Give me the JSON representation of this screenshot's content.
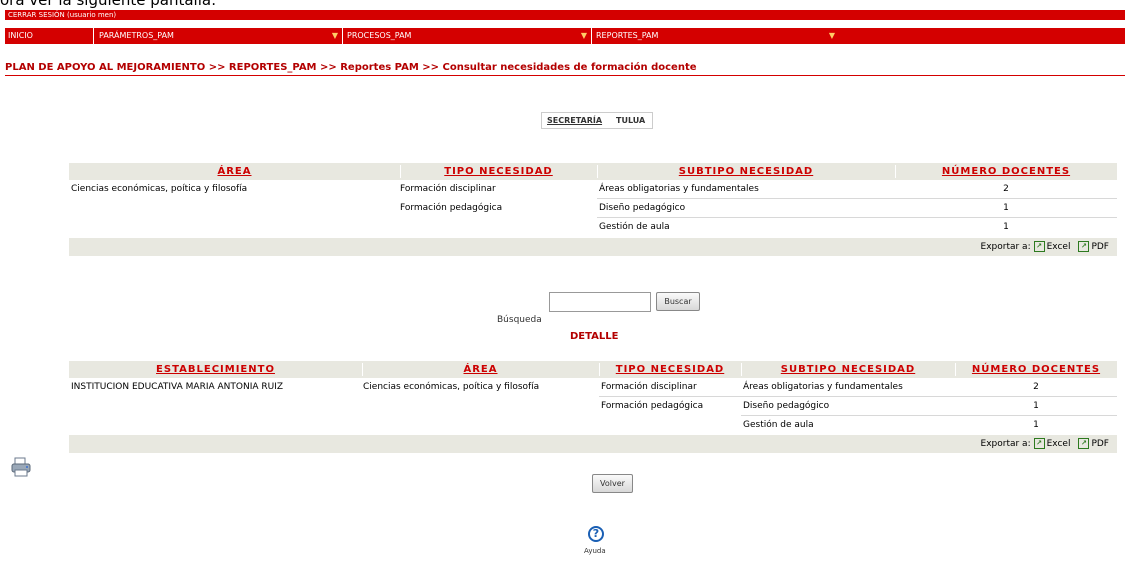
{
  "caption": "ora ver la siguiente pantalla:",
  "session": {
    "logout_label": "CERRAR SESIÓN (usuario men)"
  },
  "menu": {
    "items": [
      {
        "label": "INICIO"
      },
      {
        "label": "PARÁMETROS_PAM"
      },
      {
        "label": "PROCESOS_PAM"
      },
      {
        "label": "REPORTES_PAM"
      }
    ]
  },
  "breadcrumb": "PLAN DE APOYO AL MEJORAMIENTO >> REPORTES_PAM >> Reportes PAM >> Consultar necesidades de formación docente",
  "secretaria": {
    "label": "SECRETARÍA",
    "value": "TULUA"
  },
  "summary_table": {
    "headers": [
      "ÁREA",
      "TIPO NECESIDAD",
      "SUBTIPO NECESIDAD",
      "NÚMERO DOCENTES"
    ],
    "rows": [
      {
        "area": "Ciencias económicas, poítica y filosofía",
        "tipo": "Formación disciplinar",
        "subtipo": "Áreas obligatorias y fundamentales",
        "numero": "2"
      },
      {
        "area": "",
        "tipo": "Formación pedagógica",
        "subtipo": "Diseño pedagógico",
        "numero": "1"
      },
      {
        "area": "",
        "tipo": "",
        "subtipo": "Gestión de aula",
        "numero": "1"
      }
    ]
  },
  "export": {
    "label": "Exportar a:",
    "excel": "Excel",
    "pdf": "PDF"
  },
  "search": {
    "label": "Búsqueda",
    "value": "",
    "button": "Buscar"
  },
  "detail": {
    "title": "DETALLE",
    "headers": [
      "ESTABLECIMIENTO",
      "ÁREA",
      "TIPO NECESIDAD",
      "SUBTIPO NECESIDAD",
      "NÚMERO DOCENTES"
    ],
    "rows": [
      {
        "establecimiento": "INSTITUCION EDUCATIVA MARIA ANTONIA RUIZ",
        "area": "Ciencias económicas, poítica y filosofía",
        "tipo": "Formación disciplinar",
        "subtipo": "Áreas obligatorias y fundamentales",
        "numero": "2"
      },
      {
        "establecimiento": "",
        "area": "",
        "tipo": "Formación pedagógica",
        "subtipo": "Diseño pedagógico",
        "numero": "1"
      },
      {
        "establecimiento": "",
        "area": "",
        "tipo": "",
        "subtipo": "Gestión de aula",
        "numero": "1"
      }
    ]
  },
  "back_button": "Volver",
  "help": {
    "label": "Ayuda",
    "icon": "help-icon"
  },
  "colors": {
    "accent": "#d40000",
    "header_bg": "#e8e8e0",
    "link": "#cc0000"
  }
}
